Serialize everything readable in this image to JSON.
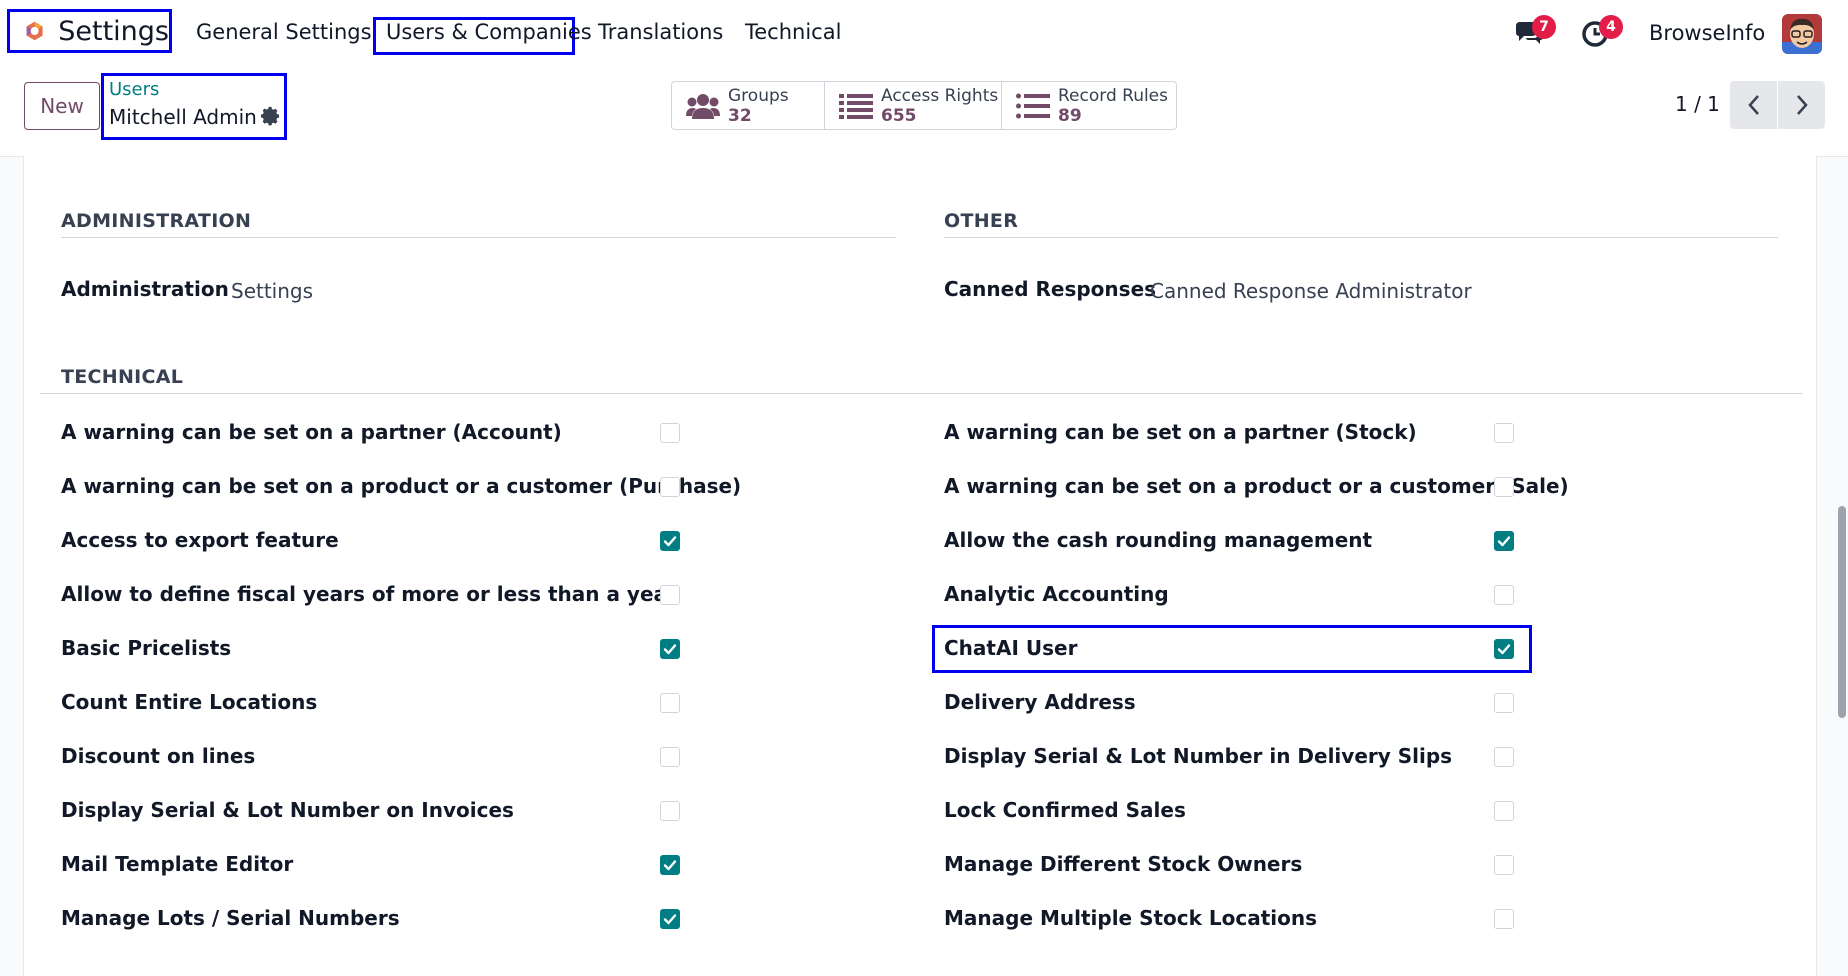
{
  "app": {
    "name": "Settings",
    "menu": [
      "General Settings",
      "Users & Companies",
      "Translations",
      "Technical"
    ]
  },
  "systray": {
    "messages_badge": "7",
    "activity_badge": "4",
    "company": "BrowseInfo"
  },
  "control": {
    "new_label": "New",
    "breadcrumb_parent": "Users",
    "breadcrumb_current": "Mitchell Admin",
    "smart_buttons": [
      {
        "label": "Groups",
        "count": "32",
        "icon": "users-icon"
      },
      {
        "label": "Access Rights",
        "count": "655",
        "icon": "list-icon"
      },
      {
        "label": "Record Rules",
        "count": "89",
        "icon": "list-icon"
      }
    ],
    "pager": "1 / 1"
  },
  "sections": {
    "administration": {
      "title": "ADMINISTRATION",
      "field_label": "Administration",
      "field_value": "Settings"
    },
    "other": {
      "title": "OTHER",
      "field_label": "Canned Responses",
      "field_value": "Canned Response Administrator"
    },
    "technical": {
      "title": "TECHNICAL",
      "left": [
        {
          "label": "A warning can be set on a partner (Account)",
          "checked": false
        },
        {
          "label": "A warning can be set on a product or a customer (Purchase)",
          "checked": false
        },
        {
          "label": "Access to export feature",
          "checked": true
        },
        {
          "label": "Allow to define fiscal years of more or less than a year",
          "checked": false
        },
        {
          "label": "Basic Pricelists",
          "checked": true
        },
        {
          "label": "Count Entire Locations",
          "checked": false
        },
        {
          "label": "Discount on lines",
          "checked": false
        },
        {
          "label": "Display Serial & Lot Number on Invoices",
          "checked": false
        },
        {
          "label": "Mail Template Editor",
          "checked": true
        },
        {
          "label": "Manage Lots / Serial Numbers",
          "checked": true
        }
      ],
      "right": [
        {
          "label": "A warning can be set on a partner (Stock)",
          "checked": false
        },
        {
          "label": "A warning can be set on a product or a customer (Sale)",
          "checked": false
        },
        {
          "label": "Allow the cash rounding management",
          "checked": true
        },
        {
          "label": "Analytic Accounting",
          "checked": false
        },
        {
          "label": "ChatAI User",
          "checked": true
        },
        {
          "label": "Delivery Address",
          "checked": false
        },
        {
          "label": "Display Serial & Lot Number in Delivery Slips",
          "checked": false
        },
        {
          "label": "Lock Confirmed Sales",
          "checked": false
        },
        {
          "label": "Manage Different Stock Owners",
          "checked": false
        },
        {
          "label": "Manage Multiple Stock Locations",
          "checked": false
        }
      ]
    }
  },
  "colors": {
    "brand": "#714b67",
    "accent": "#017e84",
    "highlight": "#0000ee"
  }
}
